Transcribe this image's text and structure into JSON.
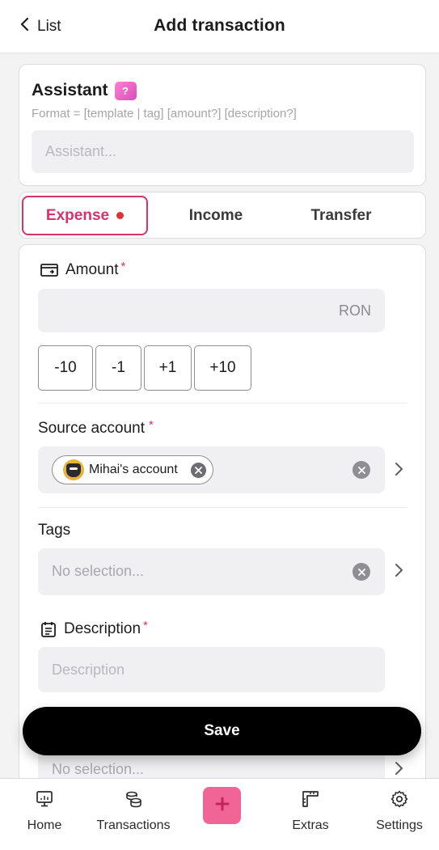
{
  "header": {
    "back_label": "List",
    "title": "Add transaction"
  },
  "assistant": {
    "title": "Assistant",
    "help_badge": "?",
    "format_hint": "Format = [template | tag] [amount?] [description?]",
    "input_placeholder": "Assistant..."
  },
  "transaction_types": {
    "active": "Expense",
    "tabs": [
      {
        "label": "Expense"
      },
      {
        "label": "Income"
      },
      {
        "label": "Transfer"
      }
    ]
  },
  "form": {
    "amount": {
      "label": "Amount",
      "required_mark": "*",
      "value": "",
      "currency": "RON",
      "steps": [
        "-10",
        "-1",
        "+1",
        "+10"
      ]
    },
    "source_account": {
      "label": "Source account",
      "required_mark": "*",
      "selected": "Mihai's account"
    },
    "tags": {
      "label": "Tags",
      "placeholder": "No selection..."
    },
    "description": {
      "label": "Description",
      "required_mark": "*",
      "placeholder": "Description"
    },
    "next_field": {
      "placeholder": "No selection..."
    }
  },
  "save_label": "Save",
  "tabbar": {
    "items": [
      {
        "label": "Home",
        "icon": "monitor-icon"
      },
      {
        "label": "Transactions",
        "icon": "coins-icon"
      },
      {
        "label": "",
        "icon": "plus-icon"
      },
      {
        "label": "Extras",
        "icon": "ruler-icon"
      },
      {
        "label": "Settings",
        "icon": "gear-icon"
      }
    ]
  },
  "colors": {
    "accent": "#d6336c",
    "fab": "#f06595",
    "dot": "#e03131"
  }
}
